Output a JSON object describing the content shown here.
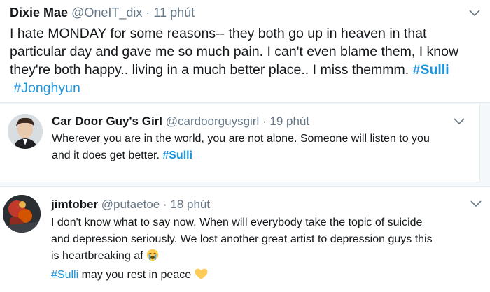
{
  "tweets": [
    {
      "name": "Dixie Mae",
      "handle": "@OneIT_dix",
      "separator": "·",
      "time": "11 phút",
      "lines": [
        "I hate MONDAY for some reasons-- they both go up in heaven in that",
        "particular day and gave me so much pain. I can't even blame them, I know",
        "they're both happy.. living in a much better place.. I miss themmm. "
      ],
      "hashtag1": "#Sulli",
      "hashtag2": "#Jonghyun"
    },
    {
      "name": "Car Door Guy's Girl",
      "handle": "@cardoorguysgirl",
      "separator": "·",
      "time": "19 phút",
      "lines": [
        "Wherever you are in the world, you are not alone. Someone will listen to you",
        "and it does get better. "
      ],
      "hashtag1": "#Sulli"
    },
    {
      "name": "jimtober",
      "handle": "@putaetoe",
      "separator": "·",
      "time": "18 phút",
      "lines": [
        "I don't know what to say now. When will everybody take the topic of suicide",
        "and depression seriously. We lost another great artist to depression guys this",
        "is heartbreaking af "
      ],
      "hashtag1": "#Sulli",
      "tail": " may you rest in peace ",
      "emoji1": "crying-face-icon",
      "emoji2": "yellow-heart-icon"
    }
  ],
  "colors": {
    "text": "#14171a",
    "muted": "#657786",
    "hashtag": "#1b95e0",
    "divider": "#e6ecf0"
  }
}
